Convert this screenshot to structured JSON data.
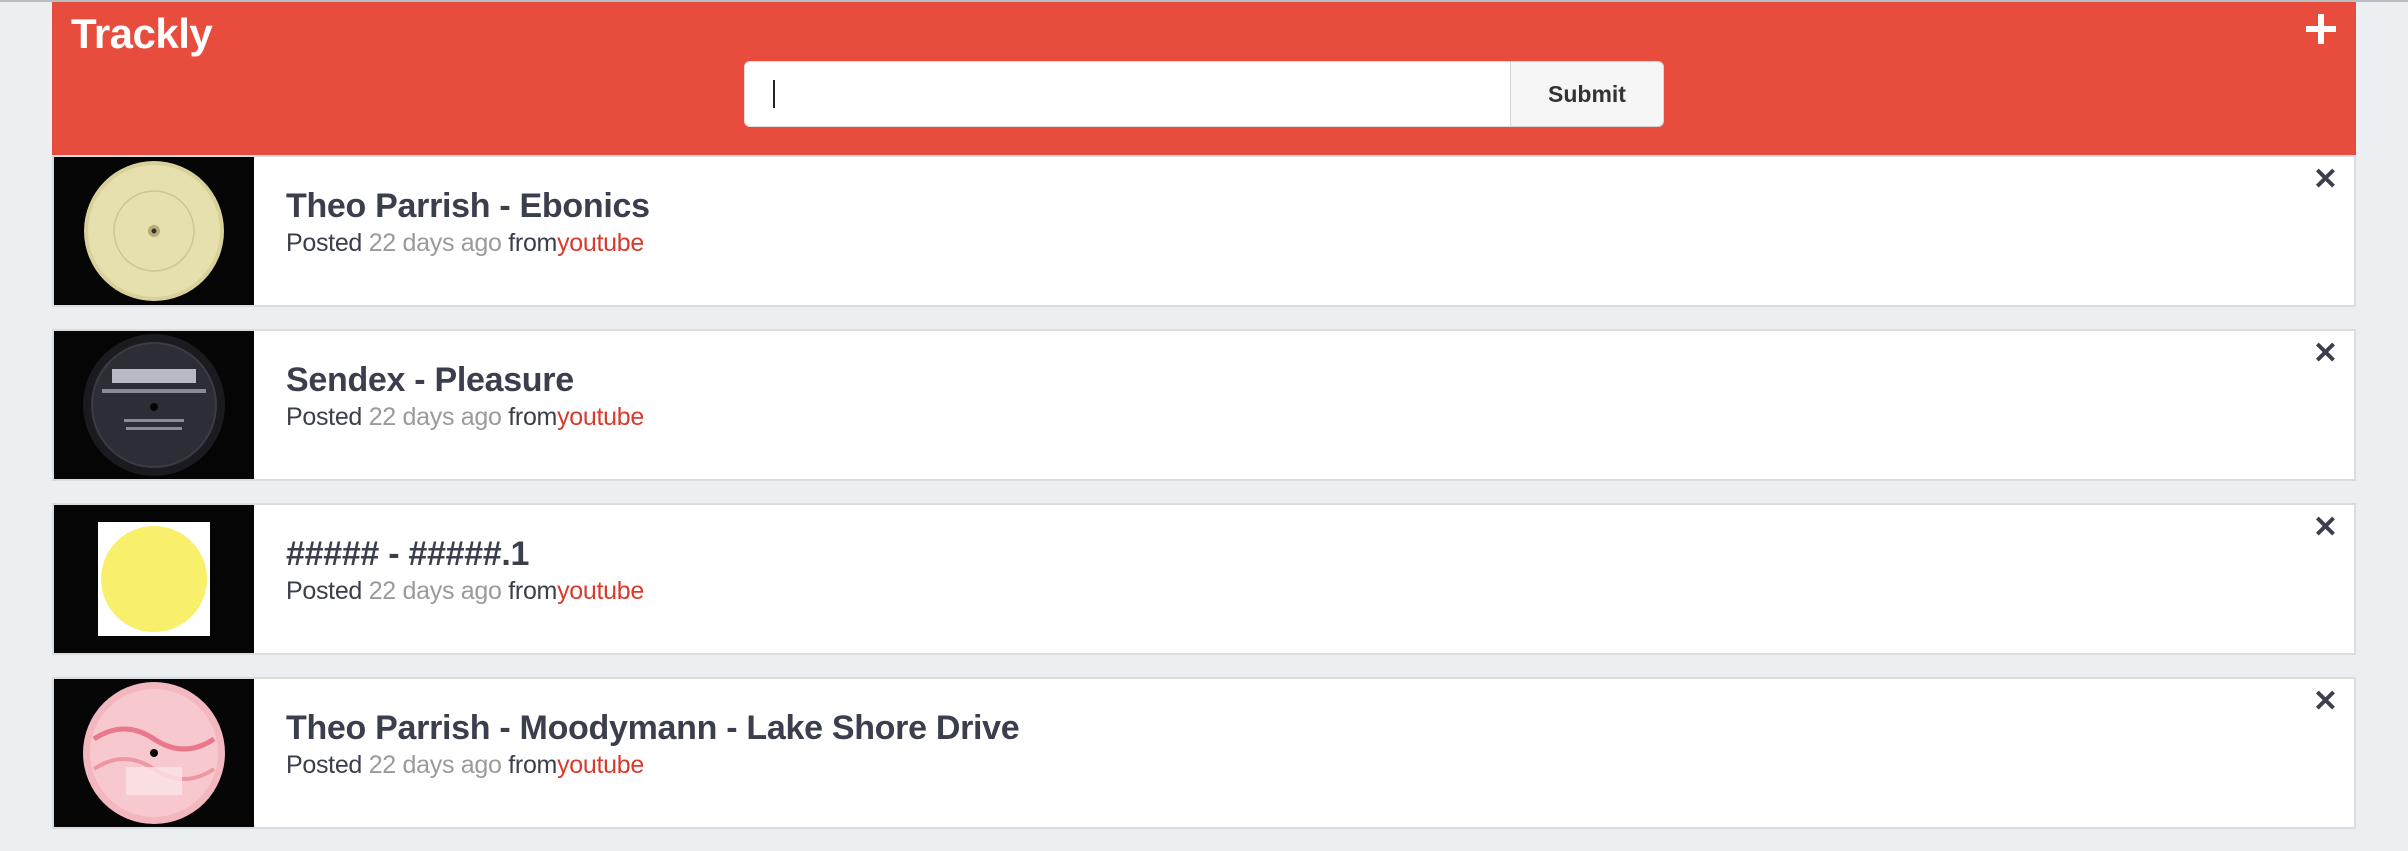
{
  "app": {
    "title": "Trackly",
    "add_icon": "plus-icon",
    "accent_color": "#e84c3d"
  },
  "search": {
    "value": "",
    "placeholder": "",
    "submit_label": "Submit"
  },
  "tracks": [
    {
      "title": "Theo Parrish - Ebonics",
      "posted_label": "Posted",
      "ago": "22 days ago",
      "from_label": "from",
      "source": "youtube",
      "thumb_kind": "vinyl-cream",
      "remove_icon": "close-icon"
    },
    {
      "title": "Sendex - Pleasure",
      "posted_label": "Posted",
      "ago": "22 days ago",
      "from_label": "from",
      "source": "youtube",
      "thumb_kind": "vinyl-black",
      "remove_icon": "close-icon"
    },
    {
      "title": "##### - #####.1",
      "posted_label": "Posted",
      "ago": "22 days ago",
      "from_label": "from",
      "source": "youtube",
      "thumb_kind": "yellow-label",
      "remove_icon": "close-icon"
    },
    {
      "title": "Theo Parrish - Moodymann - Lake Shore Drive",
      "posted_label": "Posted",
      "ago": "22 days ago",
      "from_label": "from",
      "source": "youtube",
      "thumb_kind": "vinyl-pink",
      "remove_icon": "close-icon"
    }
  ]
}
